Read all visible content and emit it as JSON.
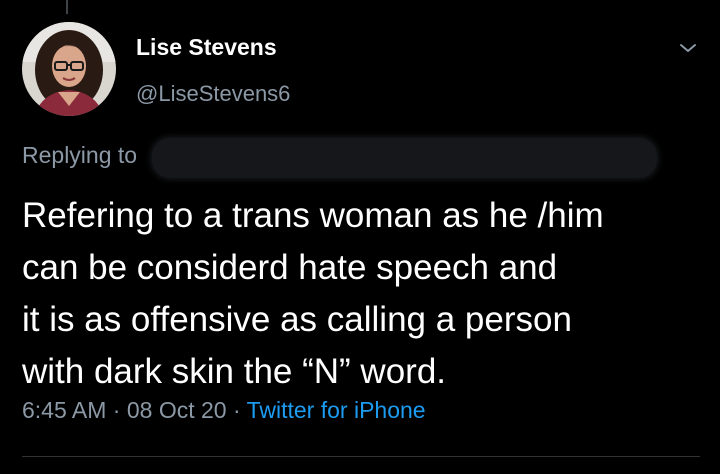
{
  "author": {
    "display_name": "Lise Stevens",
    "handle": "@LiseStevens6"
  },
  "reply": {
    "label": "Replying to"
  },
  "tweet": {
    "lines": [
      "Refering to a trans woman as he /him",
      "can be considerd hate speech and",
      "it is as offensive as calling a person",
      "with dark skin the “N” word."
    ]
  },
  "meta": {
    "time": "6:45 AM",
    "separator": " · ",
    "date": "08 Oct 20",
    "source": "Twitter for iPhone"
  },
  "icons": {
    "more": "chevron-down-icon",
    "avatar": "profile-avatar"
  },
  "colors": {
    "background": "#000000",
    "primary_text": "#ffffff",
    "secondary_text": "#8b98a5",
    "link": "#1d9bf0"
  }
}
